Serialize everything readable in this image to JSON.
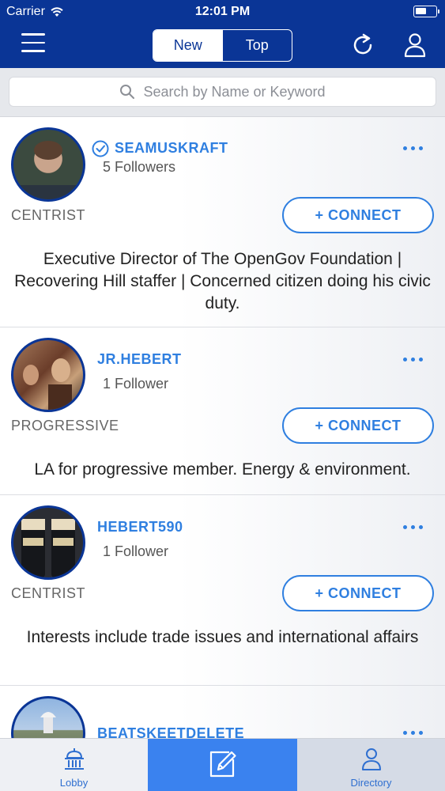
{
  "status_bar": {
    "carrier": "Carrier",
    "time": "12:01 PM"
  },
  "nav": {
    "segments": [
      {
        "label": "New",
        "active": true
      },
      {
        "label": "Top",
        "active": false
      }
    ],
    "icons": [
      "menu-icon",
      "refresh-icon",
      "profile-icon"
    ]
  },
  "search": {
    "placeholder": "Search by Name or Keyword"
  },
  "users": [
    {
      "username": "SEAMUSKRAFT",
      "verified": true,
      "followers": "5 Followers",
      "leaning": "CENTRIST",
      "connect": "+ CONNECT",
      "bio": "Executive Director of The OpenGov Foundation | Recovering Hill staffer | Concerned citizen doing his civic duty."
    },
    {
      "username": "JR.HEBERT",
      "verified": false,
      "followers": "1 Follower",
      "leaning": "PROGRESSIVE",
      "connect": "+ CONNECT",
      "bio": "LA for progressive member. Energy & environment."
    },
    {
      "username": "HEBERT590",
      "verified": false,
      "followers": "1 Follower",
      "leaning": "CENTRIST",
      "connect": "+ CONNECT",
      "bio": "Interests include trade issues and international affairs"
    },
    {
      "username": "BEATSKEETDELETE",
      "verified": false
    }
  ],
  "tabbar": [
    {
      "label": "Lobby",
      "icon": "capitol-icon"
    },
    {
      "label": "",
      "icon": "compose-icon",
      "active": true
    },
    {
      "label": "Directory",
      "icon": "person-icon"
    }
  ],
  "colors": {
    "primary": "#0a3596",
    "accent": "#2f7fe0",
    "active_tab": "#3a82ef"
  }
}
